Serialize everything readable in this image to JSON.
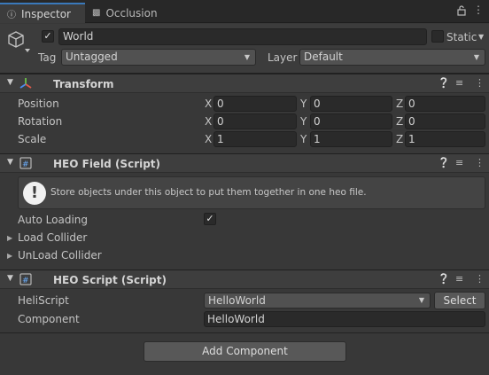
{
  "tabs": {
    "inspector": "Inspector",
    "occlusion": "Occlusion"
  },
  "header": {
    "object_name": "World",
    "active_checked": true,
    "static_label": "Static",
    "tag_label": "Tag",
    "tag_value": "Untagged",
    "layer_label": "Layer",
    "layer_value": "Default"
  },
  "transform": {
    "title": "Transform",
    "rows": [
      {
        "label": "Position",
        "x": "0",
        "y": "0",
        "z": "0"
      },
      {
        "label": "Rotation",
        "x": "0",
        "y": "0",
        "z": "0"
      },
      {
        "label": "Scale",
        "x": "1",
        "y": "1",
        "z": "1"
      }
    ],
    "axis_x": "X",
    "axis_y": "Y",
    "axis_z": "Z"
  },
  "heo_field": {
    "title": "HEO Field (Script)",
    "help_text": "Store objects under this object to put them together in one heo file.",
    "auto_loading_label": "Auto Loading",
    "auto_loading_checked": true,
    "load_collider_label": "Load Collider",
    "unload_collider_label": "UnLoad Collider"
  },
  "heo_script": {
    "title": "HEO Script (Script)",
    "heliscript_label": "HeliScript",
    "heliscript_value": "HelloWorld",
    "select_label": "Select",
    "component_label": "Component",
    "component_value": "HelloWorld"
  },
  "add_component_label": "Add Component",
  "colors": {
    "background": "#383838",
    "tab_accent": "#3a79bb",
    "field_bg": "#2a2a2a"
  }
}
